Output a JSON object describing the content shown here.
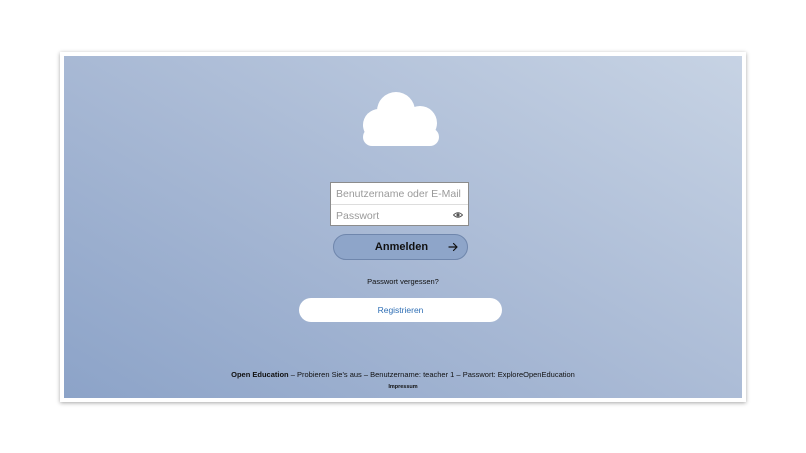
{
  "icons": {
    "logo": "cloud-icon",
    "password_toggle": "eye-icon",
    "submit": "arrow-right-icon"
  },
  "colors": {
    "background_gradient_start": "#8ca3c8",
    "background_gradient_end": "#c7d3e4",
    "login_button": "#8ea5c9",
    "register_text": "#2f6fb5"
  },
  "login": {
    "username_placeholder": "Benutzername oder E-Mail",
    "password_placeholder": "Passwort",
    "username_value": "",
    "password_value": "",
    "submit_label": "Anmelden",
    "forgot_password": "Passwort vergessen?"
  },
  "register": {
    "label": "Registrieren"
  },
  "footer": {
    "brand": "Open Education",
    "text": " – Probieren Sie's aus – Benutzername: teacher 1 – Passwort: ExploreOpenEducation",
    "impressum": "Impressum"
  }
}
